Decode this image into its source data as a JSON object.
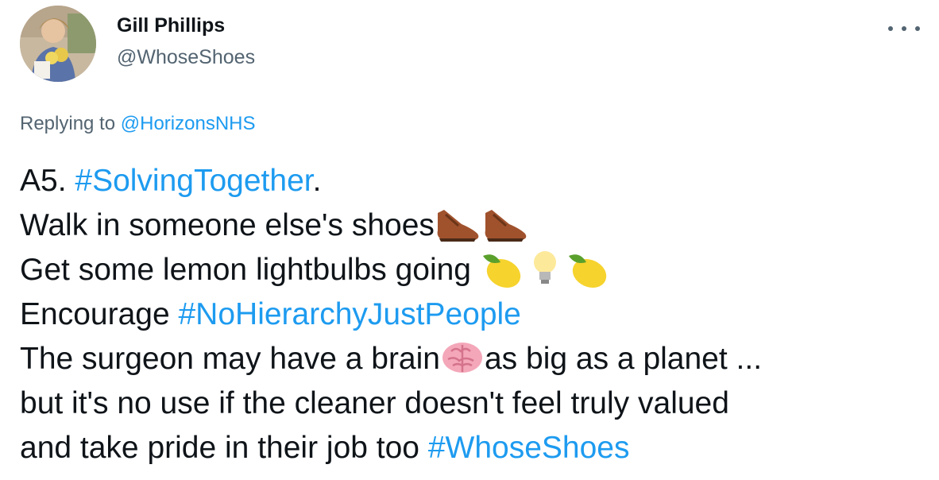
{
  "author": {
    "name": "Gill Phillips",
    "handle": "@WhoseShoes"
  },
  "more_icon": "ellipsis-icon",
  "reply": {
    "prefix": "Replying to ",
    "to": "@HorizonsNHS"
  },
  "tweet": {
    "line1_text": "A5. ",
    "line1_hashtag": "#SolvingTogether",
    "line1_end": ".",
    "line2_text": "Walk in someone else's shoes",
    "line3_text": "Get some lemon lightbulbs going ",
    "line4_text": "Encourage ",
    "line4_hashtag": "#NoHierarchyJustPeople",
    "line5_text_a": "The surgeon may have a brain",
    "line5_text_b": "as big as a planet ...",
    "line6_text": "but it's no use if the cleaner doesn't feel truly valued",
    "line7_text": "and take pride in their job too ",
    "line7_hashtag": "#WhoseShoes"
  },
  "colors": {
    "link": "#1d9bf0",
    "secondary": "#536471",
    "text": "#0f1419"
  }
}
